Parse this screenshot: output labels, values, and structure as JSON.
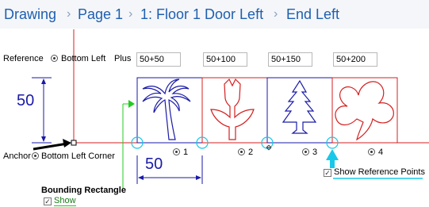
{
  "breadcrumb": {
    "items": [
      "Drawing",
      "Page 1",
      "1: Floor 1 Door Left",
      "End Left"
    ],
    "separator": "›"
  },
  "reference": {
    "label": "Reference",
    "option_label": "Bottom Left",
    "plus_label": "Plus"
  },
  "plus_fields": [
    "50+50",
    "50+100",
    "50+150",
    "50+200"
  ],
  "dimensions": {
    "vertical": "50",
    "horizontal": "50"
  },
  "anchor": {
    "label": "Anchor",
    "option_label": "Bottom Left Corner"
  },
  "shape_options": [
    "1",
    "2",
    "3",
    "4"
  ],
  "show_reference_points": {
    "label": "Show Reference Points",
    "checked": true
  },
  "bounding_rectangle": {
    "title": "Bounding Rectangle",
    "show_label": "Show",
    "show_checked": true
  },
  "colors": {
    "breadcrumb": "#1f5fb0",
    "frame_blue": "#1a1aa8",
    "frame_red": "#d42020",
    "guide_red": "#d42020",
    "guide_green": "#22cc22",
    "reference_cyan": "#18c8e8",
    "arrow_black": "#000000"
  },
  "icons": [
    "palm-tree-shape",
    "tulip-shape",
    "pine-tree-shape",
    "clover-shape",
    "cyan-up-arrow-icon",
    "black-anchor-arrow-icon"
  ]
}
